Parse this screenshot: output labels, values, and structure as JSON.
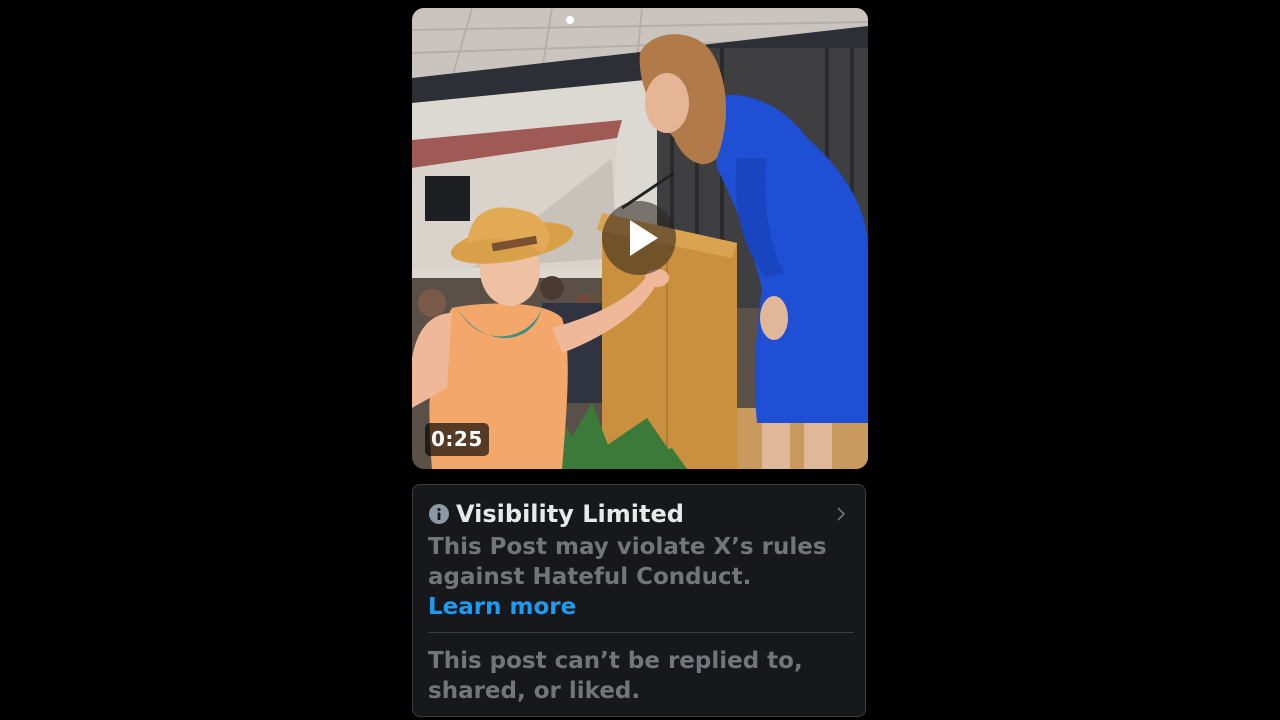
{
  "video": {
    "duration": "0:25",
    "play_icon": "play-icon"
  },
  "notice": {
    "icon": "info-icon",
    "title": "Visibility Limited",
    "body": "This Post may violate X’s rules against Hateful Conduct.",
    "link_label": "Learn more",
    "chevron_icon": "chevron-right-icon",
    "footer": "This post can’t be replied to, shared, or liked."
  },
  "colors": {
    "background": "#000000",
    "card_background": "#16181c",
    "card_border": "#3a3d42",
    "title_text": "#e7e9ea",
    "muted_text": "#71767b",
    "link": "#1d9bf0"
  }
}
